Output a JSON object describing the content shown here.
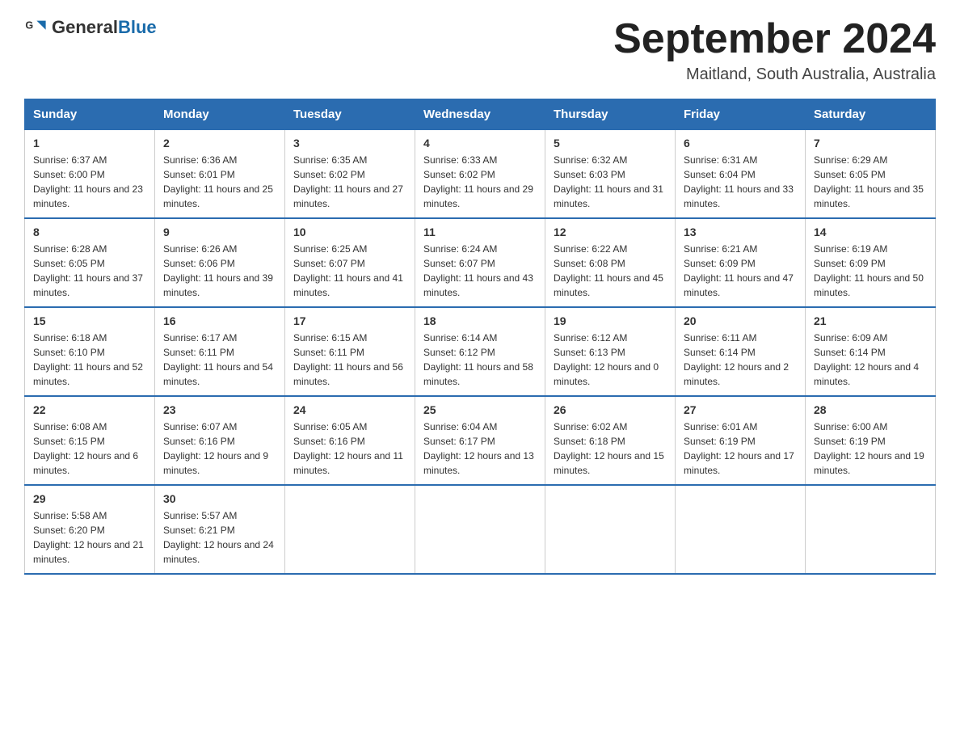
{
  "header": {
    "logo_general": "General",
    "logo_blue": "Blue",
    "month_title": "September 2024",
    "location": "Maitland, South Australia, Australia"
  },
  "days_of_week": [
    "Sunday",
    "Monday",
    "Tuesday",
    "Wednesday",
    "Thursday",
    "Friday",
    "Saturday"
  ],
  "weeks": [
    [
      {
        "day": "1",
        "sunrise": "6:37 AM",
        "sunset": "6:00 PM",
        "daylight": "11 hours and 23 minutes."
      },
      {
        "day": "2",
        "sunrise": "6:36 AM",
        "sunset": "6:01 PM",
        "daylight": "11 hours and 25 minutes."
      },
      {
        "day": "3",
        "sunrise": "6:35 AM",
        "sunset": "6:02 PM",
        "daylight": "11 hours and 27 minutes."
      },
      {
        "day": "4",
        "sunrise": "6:33 AM",
        "sunset": "6:02 PM",
        "daylight": "11 hours and 29 minutes."
      },
      {
        "day": "5",
        "sunrise": "6:32 AM",
        "sunset": "6:03 PM",
        "daylight": "11 hours and 31 minutes."
      },
      {
        "day": "6",
        "sunrise": "6:31 AM",
        "sunset": "6:04 PM",
        "daylight": "11 hours and 33 minutes."
      },
      {
        "day": "7",
        "sunrise": "6:29 AM",
        "sunset": "6:05 PM",
        "daylight": "11 hours and 35 minutes."
      }
    ],
    [
      {
        "day": "8",
        "sunrise": "6:28 AM",
        "sunset": "6:05 PM",
        "daylight": "11 hours and 37 minutes."
      },
      {
        "day": "9",
        "sunrise": "6:26 AM",
        "sunset": "6:06 PM",
        "daylight": "11 hours and 39 minutes."
      },
      {
        "day": "10",
        "sunrise": "6:25 AM",
        "sunset": "6:07 PM",
        "daylight": "11 hours and 41 minutes."
      },
      {
        "day": "11",
        "sunrise": "6:24 AM",
        "sunset": "6:07 PM",
        "daylight": "11 hours and 43 minutes."
      },
      {
        "day": "12",
        "sunrise": "6:22 AM",
        "sunset": "6:08 PM",
        "daylight": "11 hours and 45 minutes."
      },
      {
        "day": "13",
        "sunrise": "6:21 AM",
        "sunset": "6:09 PM",
        "daylight": "11 hours and 47 minutes."
      },
      {
        "day": "14",
        "sunrise": "6:19 AM",
        "sunset": "6:09 PM",
        "daylight": "11 hours and 50 minutes."
      }
    ],
    [
      {
        "day": "15",
        "sunrise": "6:18 AM",
        "sunset": "6:10 PM",
        "daylight": "11 hours and 52 minutes."
      },
      {
        "day": "16",
        "sunrise": "6:17 AM",
        "sunset": "6:11 PM",
        "daylight": "11 hours and 54 minutes."
      },
      {
        "day": "17",
        "sunrise": "6:15 AM",
        "sunset": "6:11 PM",
        "daylight": "11 hours and 56 minutes."
      },
      {
        "day": "18",
        "sunrise": "6:14 AM",
        "sunset": "6:12 PM",
        "daylight": "11 hours and 58 minutes."
      },
      {
        "day": "19",
        "sunrise": "6:12 AM",
        "sunset": "6:13 PM",
        "daylight": "12 hours and 0 minutes."
      },
      {
        "day": "20",
        "sunrise": "6:11 AM",
        "sunset": "6:14 PM",
        "daylight": "12 hours and 2 minutes."
      },
      {
        "day": "21",
        "sunrise": "6:09 AM",
        "sunset": "6:14 PM",
        "daylight": "12 hours and 4 minutes."
      }
    ],
    [
      {
        "day": "22",
        "sunrise": "6:08 AM",
        "sunset": "6:15 PM",
        "daylight": "12 hours and 6 minutes."
      },
      {
        "day": "23",
        "sunrise": "6:07 AM",
        "sunset": "6:16 PM",
        "daylight": "12 hours and 9 minutes."
      },
      {
        "day": "24",
        "sunrise": "6:05 AM",
        "sunset": "6:16 PM",
        "daylight": "12 hours and 11 minutes."
      },
      {
        "day": "25",
        "sunrise": "6:04 AM",
        "sunset": "6:17 PM",
        "daylight": "12 hours and 13 minutes."
      },
      {
        "day": "26",
        "sunrise": "6:02 AM",
        "sunset": "6:18 PM",
        "daylight": "12 hours and 15 minutes."
      },
      {
        "day": "27",
        "sunrise": "6:01 AM",
        "sunset": "6:19 PM",
        "daylight": "12 hours and 17 minutes."
      },
      {
        "day": "28",
        "sunrise": "6:00 AM",
        "sunset": "6:19 PM",
        "daylight": "12 hours and 19 minutes."
      }
    ],
    [
      {
        "day": "29",
        "sunrise": "5:58 AM",
        "sunset": "6:20 PM",
        "daylight": "12 hours and 21 minutes."
      },
      {
        "day": "30",
        "sunrise": "5:57 AM",
        "sunset": "6:21 PM",
        "daylight": "12 hours and 24 minutes."
      },
      null,
      null,
      null,
      null,
      null
    ]
  ],
  "labels": {
    "sunrise": "Sunrise:",
    "sunset": "Sunset:",
    "daylight": "Daylight:"
  }
}
